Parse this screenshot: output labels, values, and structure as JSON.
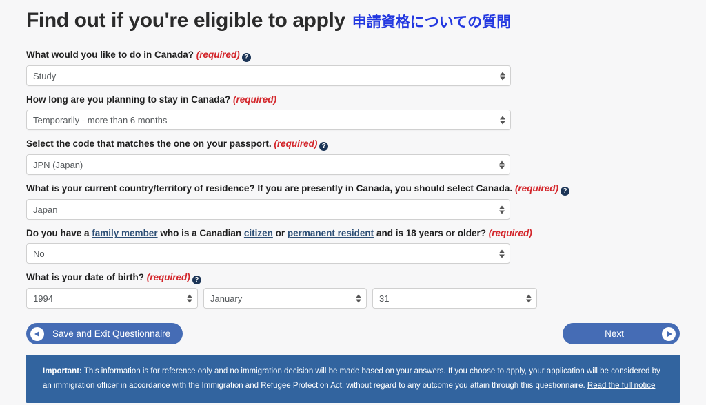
{
  "header": {
    "title": "Find out if you're eligible to apply",
    "title_secondary": "申請資格についての質問",
    "accent_blue": "#2338e0",
    "rule_color": "#d9a7a7"
  },
  "form": {
    "required_label": "(required)",
    "help_icon_glyph": "?",
    "fields": [
      {
        "label_before": "What would you like to do in Canada?",
        "has_help": true,
        "value": "Study"
      },
      {
        "label_before": "How long are you planning to stay in Canada?",
        "has_help": false,
        "value": "Temporarily - more than 6 months"
      },
      {
        "label_before": "Select the code that matches the one on your passport.",
        "has_help": true,
        "value": "JPN (Japan)"
      },
      {
        "label_before": "What is your current country/territory of residence? If you are presently in Canada, you should select Canada.",
        "has_help": true,
        "value": "Japan"
      }
    ],
    "family_field": {
      "label_part1": "Do you have a ",
      "link1": "family member",
      "label_part2": " who is a Canadian ",
      "link2": "citizen",
      "label_part3": " or ",
      "link3": "permanent resident",
      "label_part4": " and is 18 years or older?",
      "value": "No"
    },
    "dob_field": {
      "label": "What is your date of birth?",
      "year": "1994",
      "month": "January",
      "day": "31"
    }
  },
  "buttons": {
    "save_exit": "Save and Exit Questionnaire",
    "next": "Next",
    "color": "#456cb5"
  },
  "notice": {
    "important_label": "Important:",
    "text": " This information is for reference only and no immigration decision will be made based on your answers. If you choose to apply, your application will be considered by an immigration officer in accordance with the Immigration and Refugee Protection Act, without regard to any outcome you attain through this questionnaire. ",
    "link": "Read the full notice",
    "background": "#32649f"
  }
}
